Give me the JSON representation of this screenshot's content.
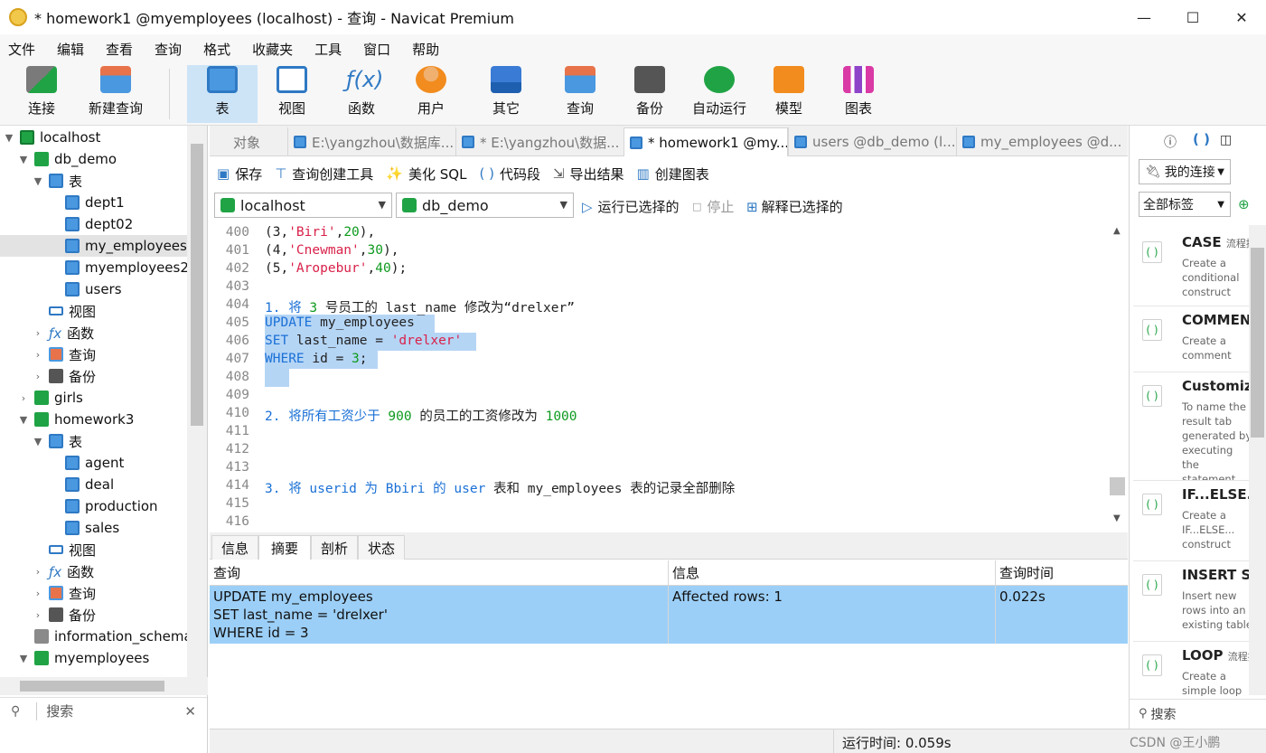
{
  "window": {
    "title": "* homework1 @myemployees (localhost) - 查询 - Navicat Premium"
  },
  "menu": [
    "文件",
    "编辑",
    "查看",
    "查询",
    "格式",
    "收藏夹",
    "工具",
    "窗口",
    "帮助"
  ],
  "toolbar": {
    "connect": "连接",
    "new_query": "新建查询",
    "table": "表",
    "view": "视图",
    "function": "函数",
    "user": "用户",
    "other": "其它",
    "query": "查询",
    "backup": "备份",
    "automation": "自动运行",
    "model": "模型",
    "chart": "图表"
  },
  "tree": {
    "localhost": "localhost",
    "db_demo": "db_demo",
    "tables_label": "表",
    "db_demo_tables": [
      "dept1",
      "dept02",
      "my_employees",
      "myemployees2",
      "users"
    ],
    "views_label": "视图",
    "functions_label": "函数",
    "queries_label": "查询",
    "backups_label": "备份",
    "girls": "girls",
    "homework3": "homework3",
    "homework3_tables": [
      "agent",
      "deal",
      "production",
      "sales"
    ],
    "information_schema": "information_schema",
    "myemployees": "myemployees",
    "search_placeholder": "搜索"
  },
  "tabs": [
    {
      "label": "对象"
    },
    {
      "label": "E:\\yangzhou\\数据库..."
    },
    {
      "label": "* E:\\yangzhou\\数据..."
    },
    {
      "label": "* homework1 @my..."
    },
    {
      "label": "users @db_demo (l..."
    },
    {
      "label": "my_employees @d..."
    }
  ],
  "query_tools": {
    "save": "保存",
    "builder": "查询创建工具",
    "beautify": "美化 SQL",
    "snippet": "代码段",
    "export": "导出结果",
    "create_chart": "创建图表"
  },
  "connection": {
    "server": "localhost",
    "database": "db_demo",
    "run_selected": "运行已选择的",
    "stop": "停止",
    "explain_selected": "解释已选择的"
  },
  "editor": {
    "line_numbers": [
      "400",
      "401",
      "402",
      "403",
      "404",
      "405",
      "406",
      "407",
      "408",
      "409",
      "410",
      "411",
      "412",
      "413",
      "414",
      "415",
      "416"
    ],
    "lines": {
      "l400_a": "(3,",
      "l400_b": "'Biri'",
      "l400_c": ",",
      "l400_d": "20",
      "l400_e": "),",
      "l401_a": "(4,",
      "l401_b": "'Cnewman'",
      "l401_c": ",",
      "l401_d": "30",
      "l401_e": "),",
      "l402_a": "(5,",
      "l402_b": "'Aropebur'",
      "l402_c": ",",
      "l402_d": "40",
      "l402_e": ");",
      "l404_a": "1. 将 ",
      "l404_b": "3",
      "l404_c": " 号员工的 last_name 修改为“drelxer”",
      "l405_a": "UPDATE",
      "l405_b": " my_employees",
      "l406_a": "SET",
      "l406_b": " last_name = ",
      "l406_c": "'drelxer'",
      "l407_a": "WHERE",
      "l407_b": " id = ",
      "l407_c": "3",
      "l407_d": ";",
      "l410_a": "2. 将所有工资少于 ",
      "l410_b": "900",
      "l410_c": " 的员工的工资修改为 ",
      "l410_d": "1000",
      "l414_a": "3. 将 userid 为 Bbiri 的 ",
      "l414_b": "user",
      "l414_c": " 表和 my_employees 表的记录全部删除"
    }
  },
  "result_tabs": [
    "信息",
    "摘要",
    "剖析",
    "状态"
  ],
  "result": {
    "headers": [
      "查询",
      "信息",
      "查询时间"
    ],
    "row": {
      "query": "UPDATE my_employees\nSET last_name = 'drelxer'\nWHERE id = 3",
      "info": "Affected rows: 1",
      "time": "0.022s"
    }
  },
  "status": {
    "run_time": "运行时间: 0.059s",
    "watermark": "CSDN @王小鹏"
  },
  "right_panel": {
    "conn_dropdown": "我的连接",
    "tag_dropdown": "全部标签",
    "search": "搜索",
    "snippets": [
      {
        "title": "CASE",
        "tag": "流程控",
        "desc": "Create a conditional construct"
      },
      {
        "title": "COMMENT",
        "tag": "",
        "desc": "Create a comment"
      },
      {
        "title": "Customize",
        "tag": "",
        "desc": "To name the result tab generated by executing the statement."
      },
      {
        "title": "IF...ELSE...",
        "tag": "",
        "desc": "Create a IF...ELSE... construct"
      },
      {
        "title": "INSERT Sy",
        "tag": "",
        "desc": "Insert new rows into an existing table"
      },
      {
        "title": "LOOP",
        "tag": "流程控",
        "desc": "Create a simple loop"
      }
    ]
  }
}
